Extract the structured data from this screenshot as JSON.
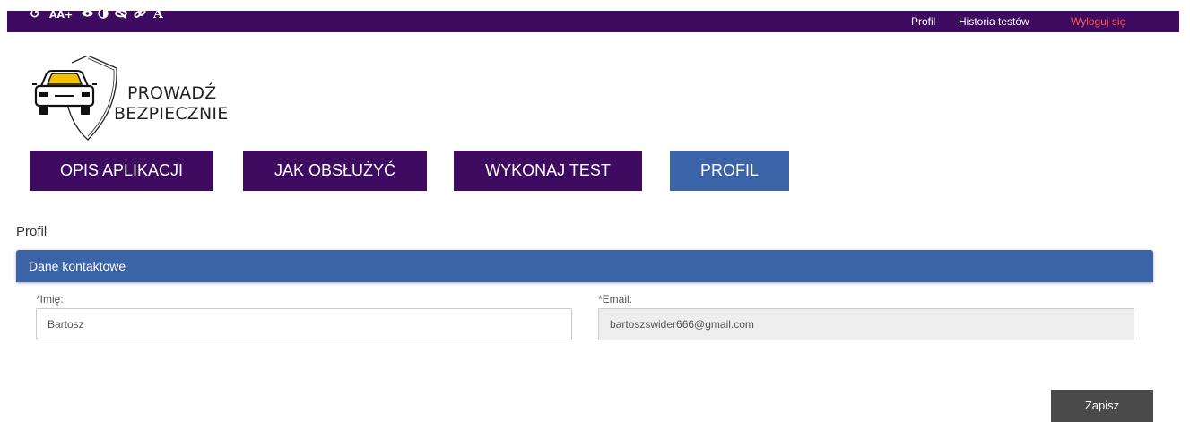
{
  "topbar": {
    "accessibility_tools": [
      {
        "name": "reset-icon",
        "glyph": "↺"
      },
      {
        "name": "font-size-icon",
        "glyph": "AA+"
      },
      {
        "name": "visibility-icon",
        "glyph": "👁"
      },
      {
        "name": "contrast-icon",
        "glyph": "◐"
      },
      {
        "name": "hide-icon",
        "glyph": "⊘"
      },
      {
        "name": "link-icon",
        "glyph": "🔗"
      },
      {
        "name": "font-icon",
        "glyph": "A"
      }
    ],
    "nav": {
      "profile": "Profil",
      "test_history": "Historia testów",
      "logout": "Wyloguj się"
    },
    "colors": {
      "background": "#3f0b61",
      "logout": "#ff5a4e"
    }
  },
  "logo": {
    "line1": "PROWADŹ",
    "line2": "BEZPIECZNIE"
  },
  "main_nav": {
    "items": [
      {
        "label": "OPIS APLIKACJI"
      },
      {
        "label": "JAK OBSŁUŻYĆ"
      },
      {
        "label": "WYKONAJ TEST"
      },
      {
        "label": "PROFIL",
        "active": true
      }
    ],
    "colors": {
      "default": "#3f0b61",
      "active": "#3b63a8"
    }
  },
  "page": {
    "title": "Profil"
  },
  "contact_panel": {
    "header": "Dane kontaktowe",
    "first_name": {
      "label": "*Imię:",
      "value": "Bartosz"
    },
    "email": {
      "label": "*Email:",
      "value": "bartoszswider666@gmail.com",
      "disabled": true
    }
  },
  "actions": {
    "save_label": "Zapisz"
  }
}
